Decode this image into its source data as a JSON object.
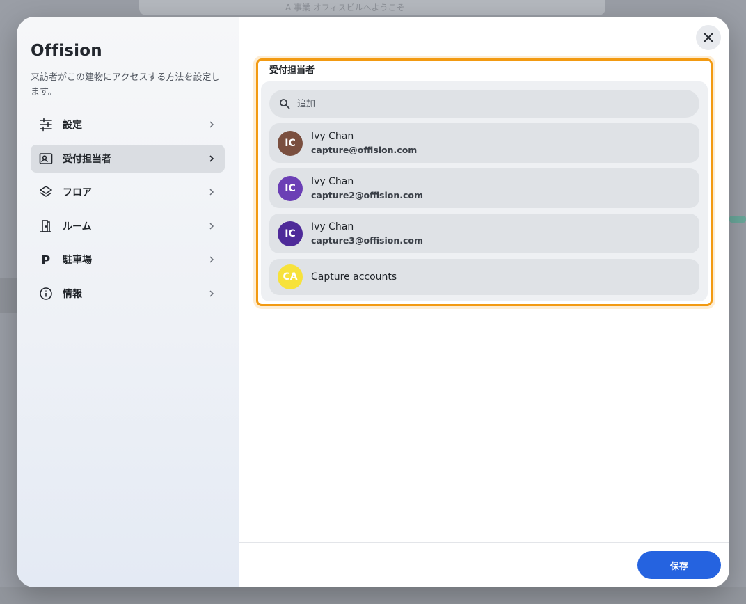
{
  "backdrop": {
    "header_text": "A 事業  オフィスビルへようこそ"
  },
  "sidebar": {
    "brand": "Offision",
    "subtitle": "来訪者がこの建物にアクセスする方法を設定します。",
    "items": [
      {
        "label": "設定",
        "icon": "sliders-icon",
        "active": false
      },
      {
        "label": "受付担当者",
        "icon": "contact-card-icon",
        "active": true
      },
      {
        "label": "フロア",
        "icon": "layers-icon",
        "active": false
      },
      {
        "label": "ルーム",
        "icon": "door-icon",
        "active": false
      },
      {
        "label": "駐車場",
        "icon": "parking-icon",
        "active": false
      },
      {
        "label": "情報",
        "icon": "info-icon",
        "active": false
      }
    ]
  },
  "panel": {
    "title": "受付担当者",
    "search_placeholder": "追加",
    "people": [
      {
        "initials": "IC",
        "name": "Ivy Chan",
        "email": "capture@offision.com",
        "color": "#7a4f3f"
      },
      {
        "initials": "IC",
        "name": "Ivy Chan",
        "email": "capture2@offision.com",
        "color": "#6b3fb5"
      },
      {
        "initials": "IC",
        "name": "Ivy Chan",
        "email": "capture3@offision.com",
        "color": "#4e2a99"
      },
      {
        "initials": "CA",
        "name": "Capture accounts",
        "email": "",
        "color": "#f7e23b"
      }
    ]
  },
  "footer": {
    "save_label": "保存"
  },
  "colors": {
    "accent": "#2563e0",
    "highlight": "#f29a12"
  }
}
